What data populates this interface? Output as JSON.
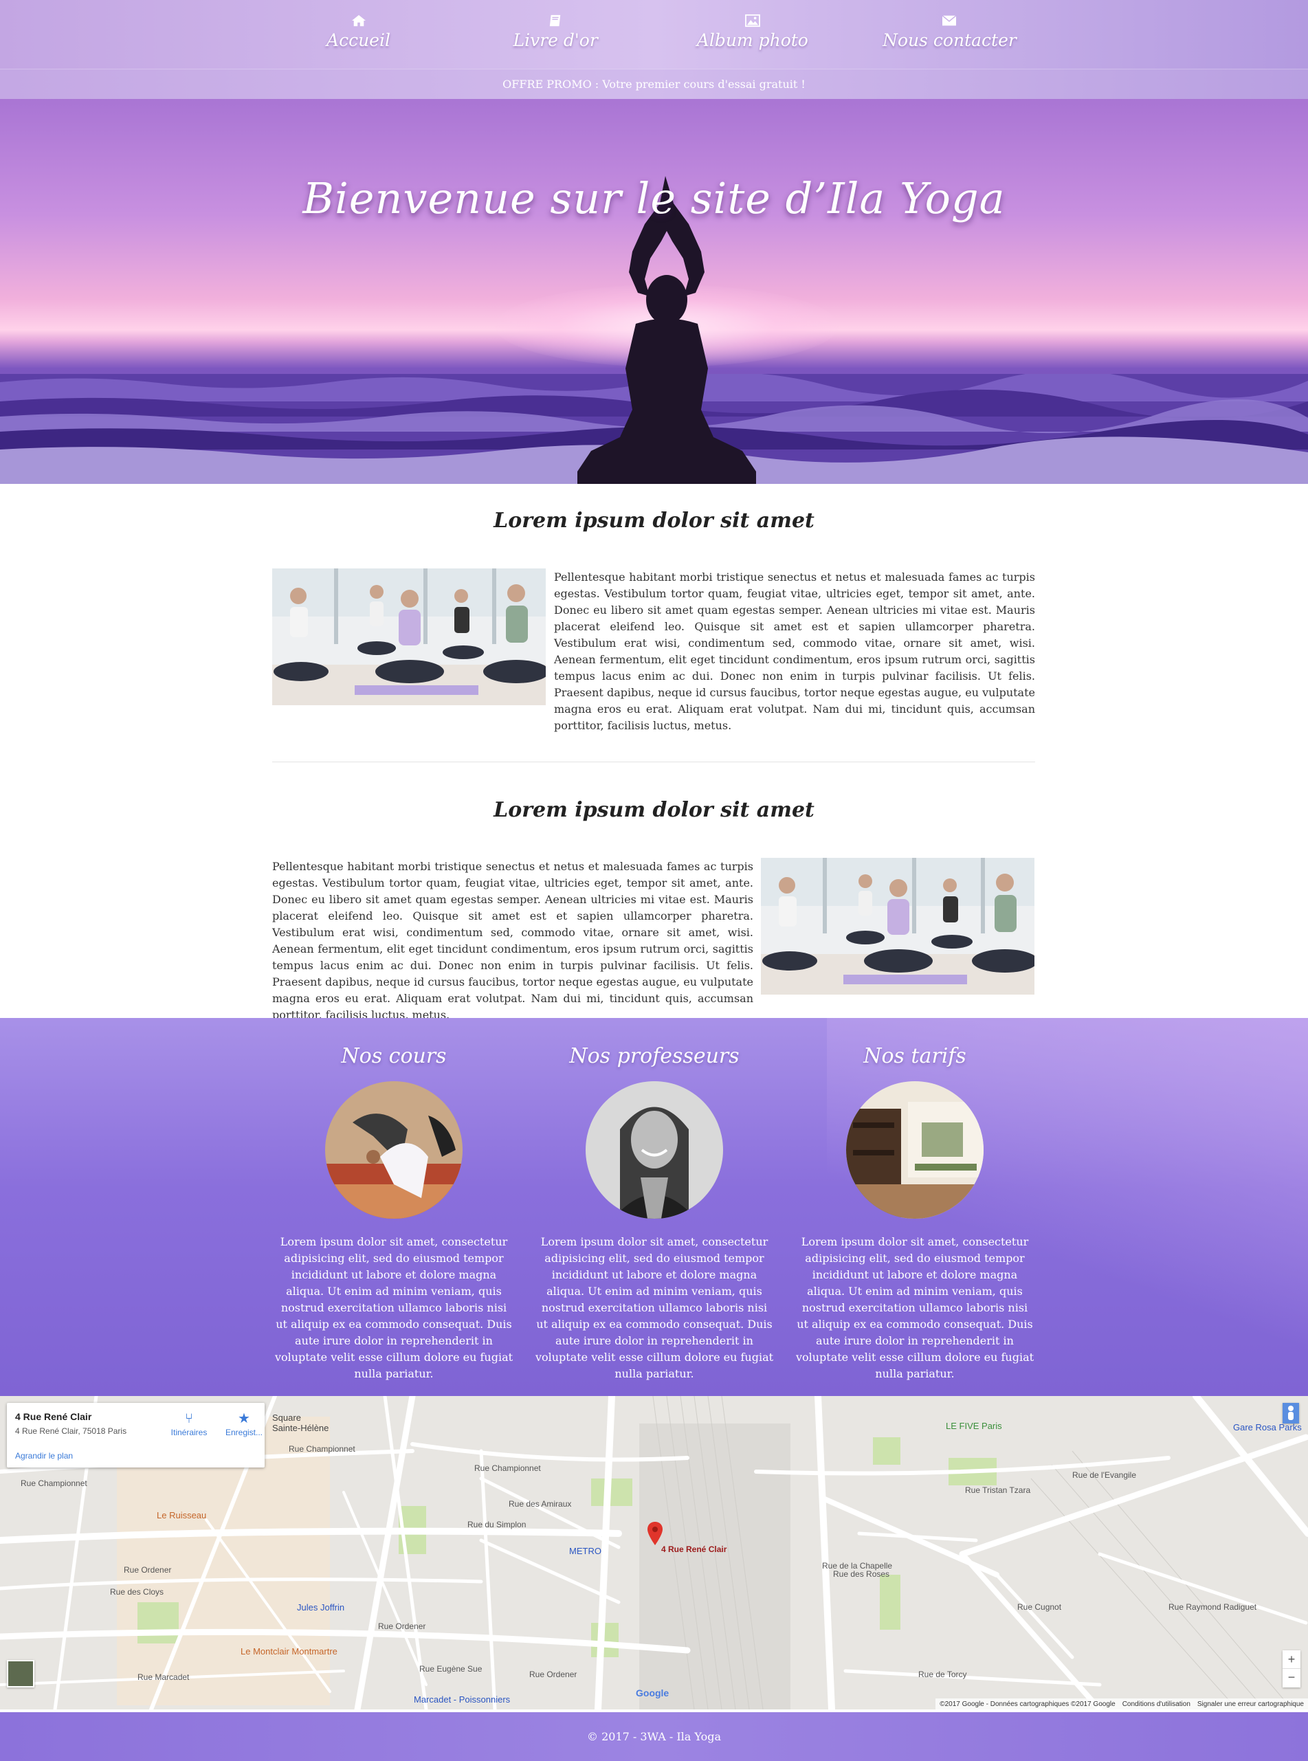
{
  "nav": {
    "items": [
      {
        "label": "Accueil",
        "icon": "home-icon"
      },
      {
        "label": "Livre d'or",
        "icon": "book-icon"
      },
      {
        "label": "Album photo",
        "icon": "picture-icon"
      },
      {
        "label": "Nous contacter",
        "icon": "envelope-icon"
      }
    ]
  },
  "promo": {
    "text": "OFFRE PROMO : Votre premier cours d'essai gratuit !"
  },
  "hero": {
    "title": "Bienvenue sur le site d’Ila Yoga"
  },
  "sections": [
    {
      "title": "Lorem ipsum dolor sit amet",
      "text": "Pellentesque habitant morbi tristique senectus et netus et malesuada fames ac turpis egestas. Vestibulum tortor quam, feugiat vitae, ultricies eget, tempor sit amet, ante. Donec eu libero sit amet quam egestas semper. Aenean ultricies mi vitae est. Mauris placerat eleifend leo. Quisque sit amet est et sapien ullamcorper pharetra. Vestibulum erat wisi, condimentum sed, commodo vitae, ornare sit amet, wisi. Aenean fermentum, elit eget tincidunt condimentum, eros ipsum rutrum orci, sagittis tempus lacus enim ac dui. Donec non enim in turpis pulvinar facilisis. Ut felis. Praesent dapibus, neque id cursus faucibus, tortor neque egestas augue, eu vulputate magna eros eu erat. Aliquam erat volutpat. Nam dui mi, tincidunt quis, accumsan porttitor, facilisis luctus, metus."
    },
    {
      "title": "Lorem ipsum dolor sit amet",
      "text": "Pellentesque habitant morbi tristique senectus et netus et malesuada fames ac turpis egestas. Vestibulum tortor quam, feugiat vitae, ultricies eget, tempor sit amet, ante. Donec eu libero sit amet quam egestas semper. Aenean ultricies mi vitae est. Mauris placerat eleifend leo. Quisque sit amet est et sapien ullamcorper pharetra. Vestibulum erat wisi, condimentum sed, commodo vitae, ornare sit amet, wisi. Aenean fermentum, elit eget tincidunt condimentum, eros ipsum rutrum orci, sagittis tempus lacus enim ac dui. Donec non enim in turpis pulvinar facilisis. Ut felis. Praesent dapibus, neque id cursus faucibus, tortor neque egestas augue, eu vulputate magna eros eu erat. Aliquam erat volutpat. Nam dui mi, tincidunt quis, accumsan porttitor, facilisis luctus, metus."
    }
  ],
  "cards": [
    {
      "title": "Nos cours",
      "text": "Lorem ipsum dolor sit amet, consectetur adipisicing elit, sed do eiusmod tempor incididunt ut labore et dolore magna aliqua. Ut enim ad minim veniam, quis nostrud exercitation ullamco laboris nisi ut aliquip ex ea commodo consequat. Duis aute irure dolor in reprehenderit in voluptate velit esse cillum dolore eu fugiat nulla pariatur."
    },
    {
      "title": "Nos professeurs",
      "text": "Lorem ipsum dolor sit amet, consectetur adipisicing elit, sed do eiusmod tempor incididunt ut labore et dolore magna aliqua. Ut enim ad minim veniam, quis nostrud exercitation ullamco laboris nisi ut aliquip ex ea commodo consequat. Duis aute irure dolor in reprehenderit in voluptate velit esse cillum dolore eu fugiat nulla pariatur."
    },
    {
      "title": "Nos tarifs",
      "text": "Lorem ipsum dolor sit amet, consectetur adipisicing elit, sed do eiusmod tempor incididunt ut labore et dolore magna aliqua. Ut enim ad minim veniam, quis nostrud exercitation ullamco laboris nisi ut aliquip ex ea commodo consequat. Duis aute irure dolor in reprehenderit in voluptate velit esse cillum dolore eu fugiat nulla pariatur."
    }
  ],
  "map": {
    "place_name": "4 Rue René Clair",
    "address": "4 Rue René Clair, 75018 Paris",
    "enlarge": "Agrandir le plan",
    "directions": "Itinéraires",
    "save": "Enregist...",
    "pin_label": "4 Rue René Clair",
    "labels": {
      "square": "Square\nSainte-Hélène",
      "champ1": "Rue Championnet",
      "champ2": "Rue Championnet",
      "champ3": "Rue Championnet",
      "ruisseau": "Le Ruisseau",
      "metro": "METRO",
      "jules": "Jules Joffrin",
      "montclair": "Le Montclair Montmartre",
      "five": "LE FIVE Paris",
      "gare": "Gare Rosa Parks",
      "evangile": "Rue de l'Evangile",
      "chapelle": "Rue de la Chapelle",
      "ordener1": "Rue Ordener",
      "ordener2": "Rue Ordener",
      "ordener3": "Rue Ordener",
      "cloys": "Rue des Cloys",
      "simplon": "Rue du Simplon",
      "amiraux": "Rue des Amiraux",
      "roses": "Rue des Roses",
      "tristan": "Rue Tristan Tzara",
      "marcadet": "Rue Marcadet",
      "torcy": "Rue de Torcy",
      "eugene": "Rue Eugène Sue",
      "poissonniers": "Marcadet - Poissonniers",
      "raymond": "Rue Raymond Radiguet",
      "cugnot": "Rue Cugnot"
    },
    "attribution": "©2017 Google - Données cartographiques ©2017 Google",
    "terms": "Conditions d'utilisation",
    "report": "Signaler une erreur cartographique",
    "google": "Google"
  },
  "footer": {
    "text": "© 2017 - 3WA - Ila Yoga"
  },
  "colors": {
    "accent": "#8c72db",
    "nav": "#c3a6e3"
  }
}
